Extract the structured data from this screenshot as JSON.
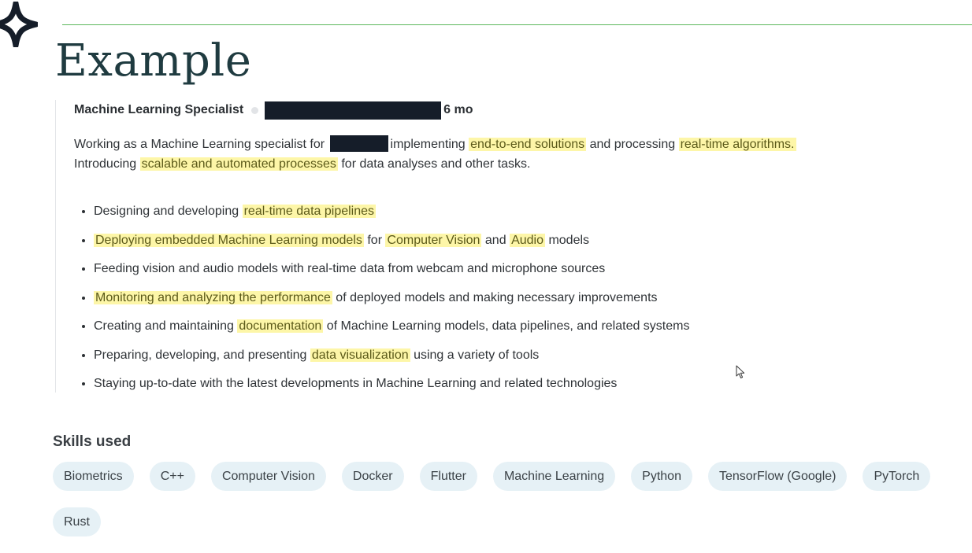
{
  "slide": {
    "title": "Example"
  },
  "experience": {
    "role": "Machine Learning Specialist",
    "duration": "6 mo",
    "description": {
      "p1": "Working as a Machine Learning specialist for",
      "p2": "implementing",
      "h1": "end-to-end solutions",
      "p3": "and processing",
      "h2": "real-time algorithms.",
      "p4": "Introducing",
      "h3": "scalable and automated processes",
      "p5": "for data analyses and other tasks."
    },
    "bullets": [
      {
        "t1": "Designing and developing",
        "h1": "real-time data pipelines"
      },
      {
        "h1": "Deploying embedded Machine Learning models",
        "t1": "for",
        "h2": "Computer Vision",
        "t2": "and",
        "h3": "Audio",
        "t3": "models"
      },
      {
        "t1": "Feeding vision and audio models with real-time data from webcam and microphone sources"
      },
      {
        "h1": "Monitoring and analyzing the performance",
        "t1": "of deployed models and making necessary improvements"
      },
      {
        "t1": "Creating and maintaining",
        "h1": "documentation",
        "t2": "of Machine Learning models, data pipelines, and related systems"
      },
      {
        "t1": "Preparing, developing, and presenting",
        "h1": "data visualization",
        "t2": "using a variety of tools"
      },
      {
        "t1": "Staying up-to-date with the latest developments in Machine Learning and related technologies"
      }
    ]
  },
  "skills": {
    "heading": "Skills used",
    "items": [
      "Biometrics",
      "C++",
      "Computer Vision",
      "Docker",
      "Flutter",
      "Machine Learning",
      "Python",
      "TensorFlow (Google)",
      "PyTorch",
      "Rust"
    ]
  },
  "colors": {
    "accent_line": "#5cb85c",
    "title": "#1f3b40",
    "highlight": "#fdf6a8",
    "chip_bg": "#e6f1f6",
    "redaction": "#151d29"
  },
  "icons": {
    "logo": "four-point-star-logo",
    "cursor": "mouse-pointer-icon"
  }
}
